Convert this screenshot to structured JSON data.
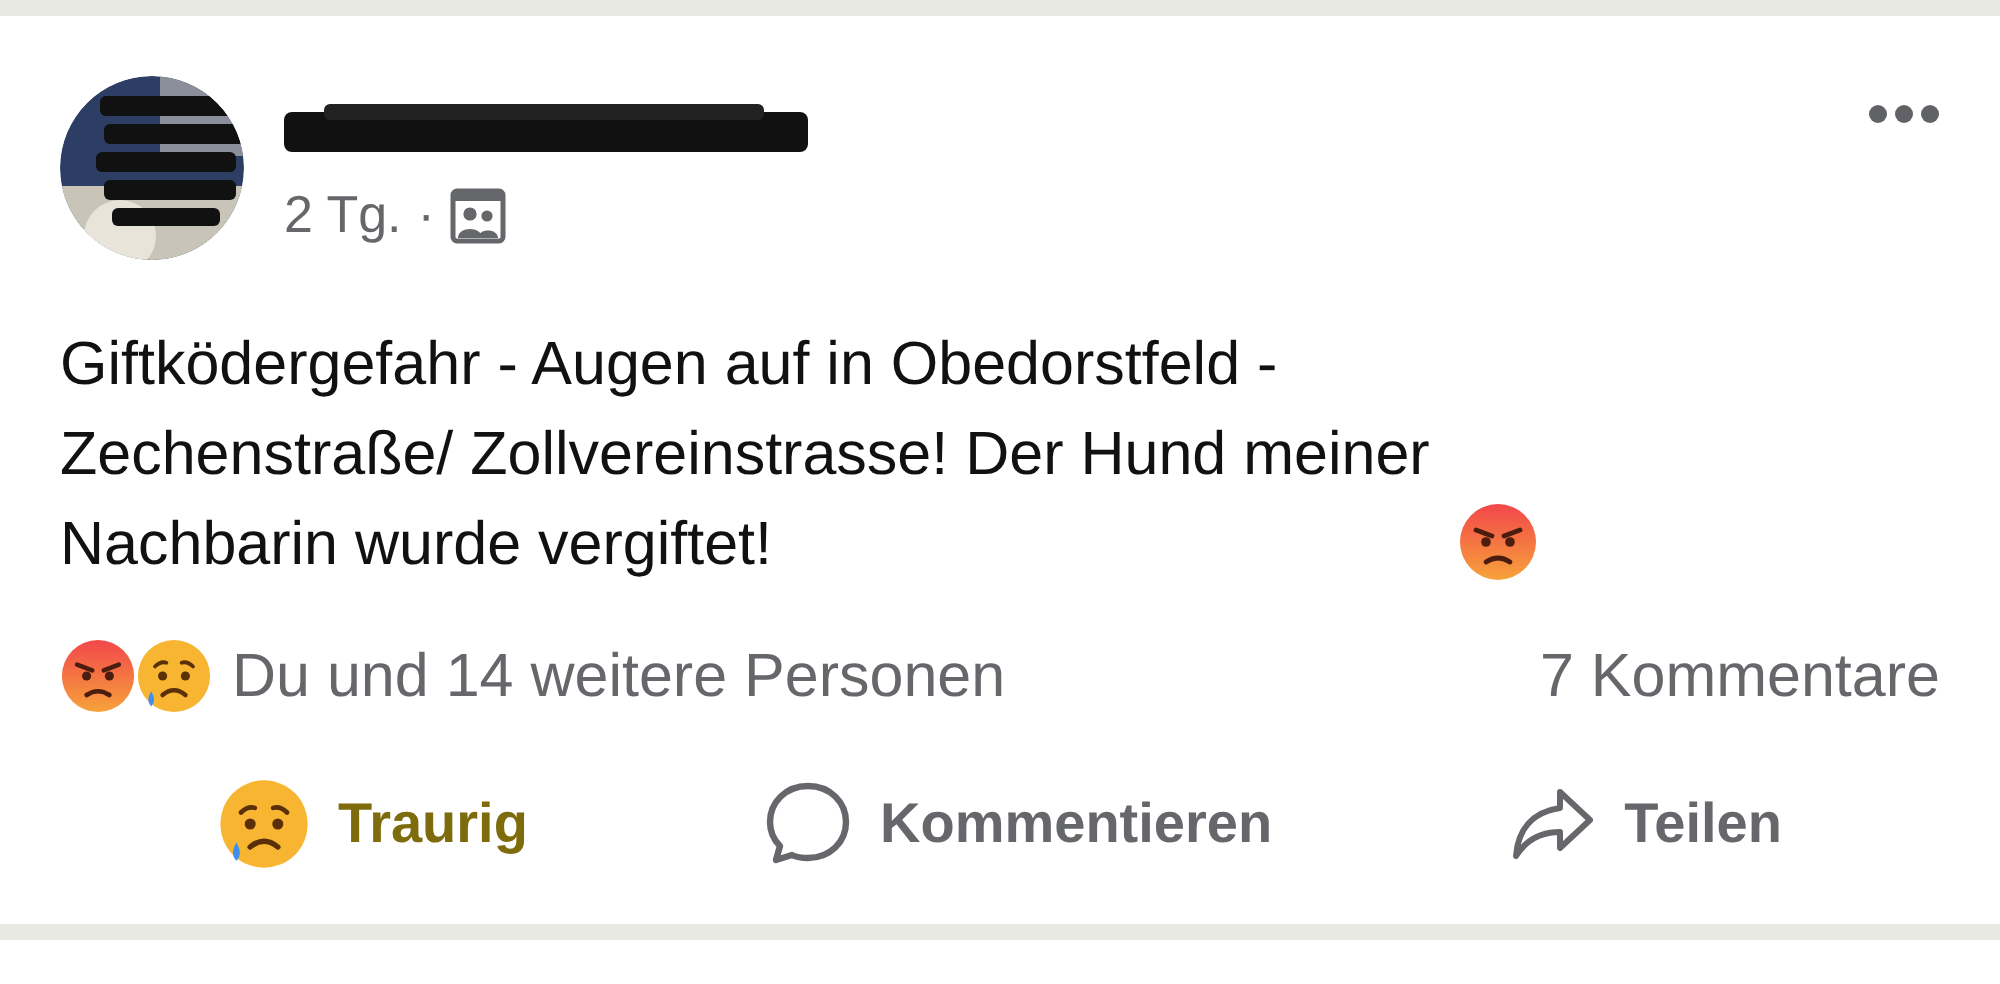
{
  "post": {
    "time": "2 Tg.",
    "separator": "·",
    "text": "Giftködergefahr - Augen auf in Obedorstfeld -\nZechenstraße/ Zollvereinstrasse! Der Hund meiner\nNachbarin wurde vergiftet!"
  },
  "reactions": {
    "summary": "Du und 14 weitere Personen",
    "comments": "7 Kommentare"
  },
  "actions": [
    {
      "label": "Traurig",
      "kind": "reaction",
      "selected": true
    },
    {
      "label": "Kommentieren",
      "kind": "comment",
      "selected": false
    },
    {
      "label": "Teilen",
      "kind": "share",
      "selected": false
    }
  ]
}
